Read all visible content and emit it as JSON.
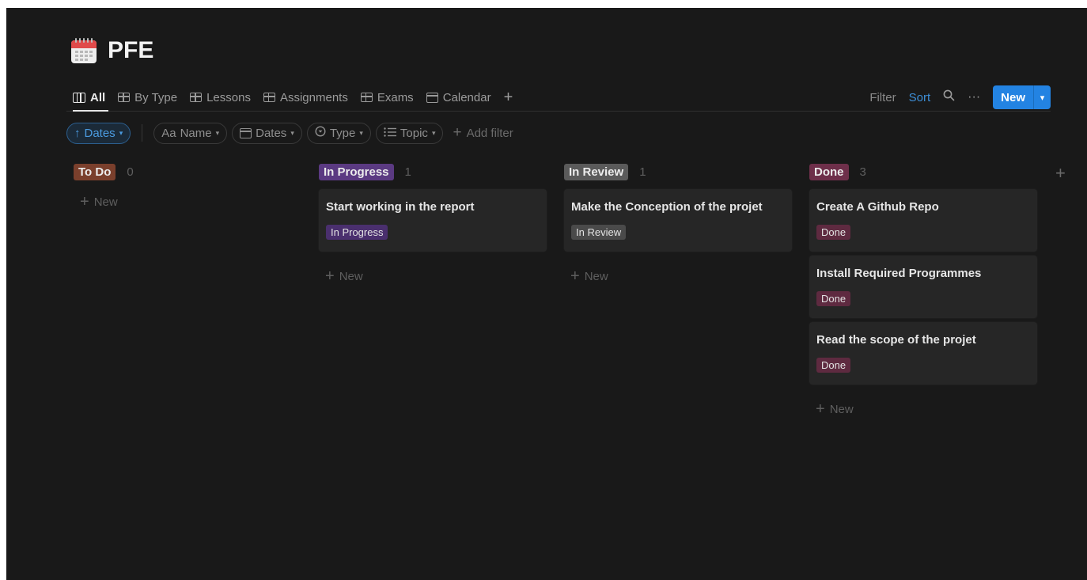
{
  "page": {
    "title": "PFE",
    "icon": "calendar-icon"
  },
  "views": {
    "tabs": [
      {
        "label": "All",
        "icon": "board-icon",
        "active": true
      },
      {
        "label": "By Type",
        "icon": "table-icon"
      },
      {
        "label": "Lessons",
        "icon": "table-icon"
      },
      {
        "label": "Assignments",
        "icon": "table-icon"
      },
      {
        "label": "Exams",
        "icon": "table-icon"
      },
      {
        "label": "Calendar",
        "icon": "calendar-view-icon"
      }
    ],
    "add_view": "+"
  },
  "actions": {
    "filter": "Filter",
    "sort": "Sort",
    "search_icon": "search-icon",
    "more": "···",
    "new": "New"
  },
  "filters": {
    "sort_chip": "Dates",
    "chips": [
      "Name",
      "Dates",
      "Type",
      "Topic"
    ],
    "name_prefix": "Aa",
    "add_filter": "Add filter"
  },
  "board": {
    "new_label": "New",
    "columns": [
      {
        "name": "To Do",
        "count": "0",
        "color": "#7a3f2c",
        "cards": []
      },
      {
        "name": "In Progress",
        "count": "1",
        "color": "#5b3a82",
        "cards": [
          {
            "title": "Start working in the report",
            "tag": "In Progress"
          }
        ]
      },
      {
        "name": "In Review",
        "count": "1",
        "color": "#5a5a5a",
        "cards": [
          {
            "title": "Make the Conception of the projet",
            "tag": "In Review"
          }
        ]
      },
      {
        "name": "Done",
        "count": "3",
        "color": "#6e2f4a",
        "cards": [
          {
            "title": "Create A Github Repo",
            "tag": "Done"
          },
          {
            "title": "Install Required Programmes",
            "tag": "Done"
          },
          {
            "title": "Read the scope of the projet",
            "tag": "Done"
          }
        ]
      }
    ]
  },
  "colors": {
    "background": "#191919",
    "accent": "#2383e2",
    "card": "#262626"
  }
}
